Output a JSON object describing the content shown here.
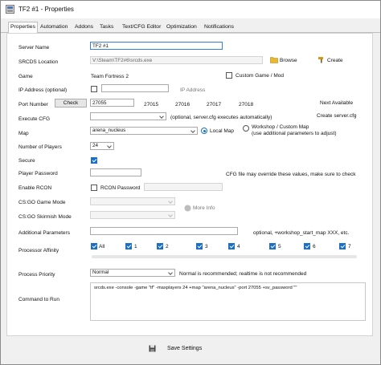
{
  "window": {
    "title": "TF2 #1 - Properties"
  },
  "tabs": [
    "Properties",
    "Automation",
    "Addons",
    "Tasks",
    "Text/CFG Editor",
    "Optimization",
    "Notifications"
  ],
  "form": {
    "server_name": {
      "label": "Server Name",
      "value": "TF2 #1"
    },
    "srcds_location": {
      "label": "SRCDS Location",
      "value": "V:\\Steam\\TF2#6\\srcds.exe",
      "browse": "Browse",
      "create": "Create"
    },
    "game": {
      "label": "Game",
      "value": "Team Fortress 2",
      "custom": "Custom Game / Mod"
    },
    "ip": {
      "label": "IP Address (optional)",
      "hint": "IP Address"
    },
    "port": {
      "label": "Port Number",
      "check": "Check",
      "value": "27055",
      "ports": [
        "27015",
        "27016",
        "27017",
        "27018"
      ],
      "next": "Next Available"
    },
    "execute_cfg": {
      "label": "Execute CFG",
      "hint": "(optional, server.cfg executes automatically)",
      "create": "Create server.cfg"
    },
    "map": {
      "label": "Map",
      "value": "arena_nucleus",
      "local": "Local Map",
      "workshop": "Workshop / Custom Map",
      "workshop_hint": "(use additional parameters to adjust)"
    },
    "players": {
      "label": "Number of Players",
      "value": "24"
    },
    "secure": {
      "label": "Secure"
    },
    "player_password": {
      "label": "Player Password",
      "note": "CFG file may override these values, make sure to check"
    },
    "rcon": {
      "label": "Enable RCON",
      "password": "RCON Password"
    },
    "csgo_mode": {
      "label": "CS:GO Game Mode"
    },
    "csgo_skirmish": {
      "label": "CS:GO Skirmish Mode",
      "more": "More Info"
    },
    "additional": {
      "label": "Additional Parameters",
      "hint": "optional, +workshop_start_map XXX, etc."
    },
    "affinity": {
      "label": "Processor Affinity",
      "cores": [
        "All",
        "1",
        "2",
        "3",
        "4",
        "5",
        "6",
        "7"
      ]
    },
    "priority": {
      "label": "Process Priority",
      "value": "Normal",
      "note": "Normal is recommended; realtime is not recommended"
    },
    "command": {
      "label": "Command to Run",
      "value": "srcds.exe -console -game \"tf\" -maxplayers 24 +map \"arena_nucleus\" -port 27055 +sv_password \"\""
    }
  },
  "footer": {
    "save": "Save Settings"
  },
  "colors": {
    "accent": "#1a6fc9",
    "window_bg": "#f0f0f0",
    "panel_bg": "#ffffff"
  }
}
